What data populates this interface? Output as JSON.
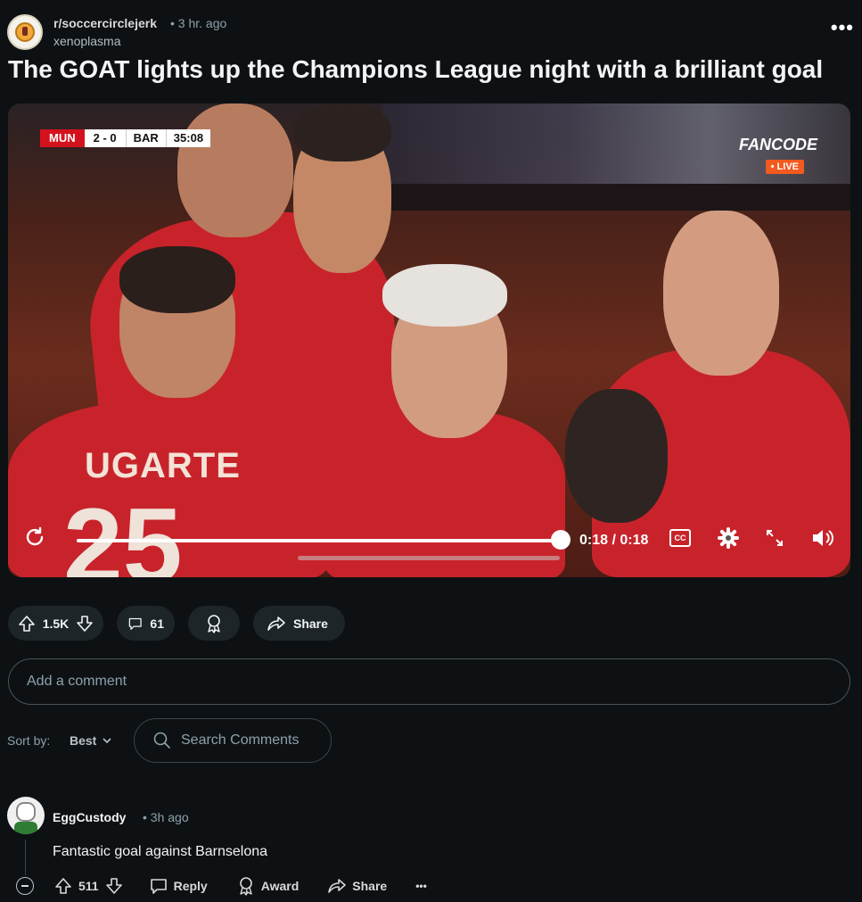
{
  "post": {
    "subreddit": "r/soccercirclejerk",
    "time": "• 3 hr. ago",
    "author": "xenoplasma",
    "more": "•••",
    "title": "The GOAT lights up the Champions League night with a brilliant goal"
  },
  "video": {
    "scoreboard": {
      "home": "MUN",
      "score": "2 - 0",
      "away": "BAR",
      "clock": "35:08"
    },
    "broadcaster": "FANCODE",
    "live": "• LIVE",
    "shirt_name": "UGARTE",
    "shirt_number": "25",
    "time": "0:18 / 0:18",
    "cc": "CC",
    "progress": 1.0
  },
  "actions": {
    "votes": "1.5K",
    "comments": "61",
    "share": "Share"
  },
  "comment_input": {
    "placeholder": "Add a comment"
  },
  "sort": {
    "label": "Sort by:",
    "value": "Best"
  },
  "search": {
    "placeholder": "Search Comments"
  },
  "comment": {
    "author": "EggCustody",
    "time": "• 3h ago",
    "body": "Fantastic goal against Barnselona",
    "votes": "511",
    "reply": "Reply",
    "award": "Award",
    "share": "Share",
    "more": "•••"
  },
  "colors": {
    "background": "#0e1113",
    "pill": "#1d2529",
    "live": "#f25a1e",
    "mun_red": "#d4121e"
  }
}
